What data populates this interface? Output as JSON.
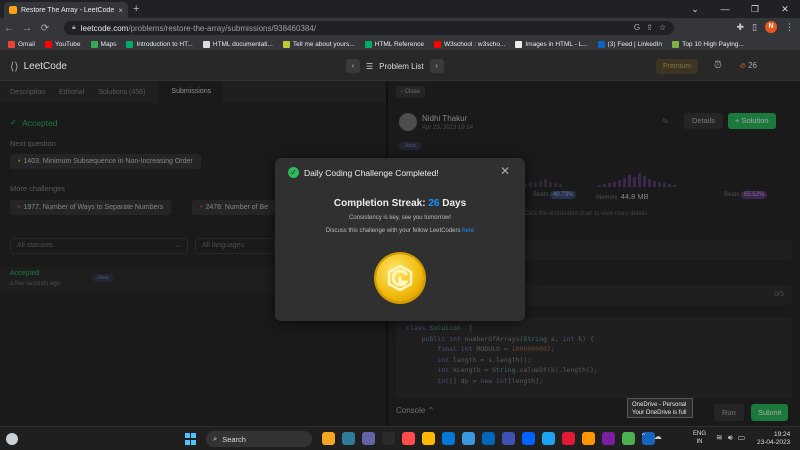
{
  "browser": {
    "tab_title": "Restore The Array - LeetCode",
    "tab_close": "×",
    "new_tab": "+",
    "url_host": "leetcode.com",
    "url_path": "/problems/restore-the-array/submissions/938460384/",
    "window_controls": [
      "⌄",
      "—",
      "❐",
      "✕"
    ],
    "profile_initial": "N",
    "bookmarks": [
      {
        "label": "Gmail",
        "color": "#ea4335"
      },
      {
        "label": "YouTube",
        "color": "#ff0000"
      },
      {
        "label": "Maps",
        "color": "#34a853"
      },
      {
        "label": "Introduction to HT...",
        "color": "#04aa6d"
      },
      {
        "label": "HTML documentati...",
        "color": "#dddddd"
      },
      {
        "label": "Tell me about yours...",
        "color": "#c0ca33"
      },
      {
        "label": "HTML Reference",
        "color": "#04aa6d"
      },
      {
        "label": "W3school : w3scho...",
        "color": "#ff0000"
      },
      {
        "label": "Images in HTML - L...",
        "color": "#eeeeee"
      },
      {
        "label": "(3) Feed | LinkedIn",
        "color": "#0a66c2"
      },
      {
        "label": "Top 10 High Paying...",
        "color": "#7cb342"
      }
    ]
  },
  "lc_nav": {
    "logo_text": "LeetCode",
    "problem_list": "Problem List",
    "premium": "Premium",
    "streak_count": "26"
  },
  "left": {
    "tabs": [
      "Description",
      "Editorial",
      "Solutions (456)",
      "Submissions"
    ],
    "accepted_label": "Accepted",
    "next_question_label": "Next question",
    "next_question": "1403. Minimum Subsequence in Non-Increasing Order",
    "more_challenges_label": "More challenges",
    "challenge1": "1977. Number of Ways to Separate Numbers",
    "challenge2": "2478. Number of Be",
    "filter_status": "All statuses",
    "filter_lang": "All languages",
    "submission": {
      "status": "Accepted",
      "time": "a few seconds ago",
      "lang": "Java"
    }
  },
  "right": {
    "close": "Close",
    "user_name": "Nidhi Thakur",
    "date": "Apr 23, 2023 19:24",
    "details": "Details",
    "solution": "+ Solution",
    "lang_tag": "Java",
    "beats_label": "Beats",
    "beats_runtime": "40.73%",
    "memory_label": "Memory",
    "memory_value": "44.8 MB",
    "beats_memory": "65.52%",
    "dist_note": "Click the distribution chart to view more details",
    "pagination": "0/5",
    "code_lines": [
      {
        "parts": [
          [
            "kw",
            "class "
          ],
          [
            "ty",
            "Solution"
          ],
          [
            "",
            "  {"
          ]
        ]
      },
      {
        "parts": [
          [
            "",
            "    "
          ],
          [
            "kw",
            "public "
          ],
          [
            "kw",
            "int "
          ],
          [
            "",
            "numberOfArrays("
          ],
          [
            "ty",
            "String "
          ],
          [
            "",
            "s, "
          ],
          [
            "kw",
            "int "
          ],
          [
            "",
            "k) {"
          ]
        ]
      },
      {
        "parts": [
          [
            "",
            ""
          ]
        ]
      },
      {
        "parts": [
          [
            "",
            "        "
          ],
          [
            "kw",
            "final "
          ],
          [
            "kw",
            "int "
          ],
          [
            "",
            "MODULO = "
          ],
          [
            "num",
            "1000000007"
          ],
          [
            "",
            ";"
          ]
        ]
      },
      {
        "parts": [
          [
            "",
            "        "
          ],
          [
            "kw",
            "int "
          ],
          [
            "",
            "length = s.length();"
          ]
        ]
      },
      {
        "parts": [
          [
            "",
            "        "
          ],
          [
            "kw",
            "int "
          ],
          [
            "",
            "kLength = "
          ],
          [
            "ty",
            "String"
          ],
          [
            "",
            ".valueOf(k).length();"
          ]
        ]
      },
      {
        "parts": [
          [
            "",
            "        "
          ],
          [
            "kw",
            "int"
          ],
          [
            "",
            "[] dp = "
          ],
          [
            "kw",
            "new "
          ],
          [
            "kw",
            "int"
          ],
          [
            "",
            "[length];"
          ]
        ]
      }
    ],
    "console": "Console ⌃",
    "run": "Run",
    "submit": "Submit"
  },
  "modal": {
    "title": "Daily Coding Challenge Completed!",
    "close": "✕",
    "streak_prefix": "Completion Streak:",
    "streak_value": "26",
    "streak_suffix": "Days",
    "message": "Consistency is key, see you tomorrow!",
    "discuss_text": "Discuss this challenge with your fellow LeetCoders",
    "discuss_link": "here"
  },
  "taskbar": {
    "search": "Search",
    "lang_top": "ENG",
    "lang_bottom": "IN",
    "time": "19:24",
    "date": "23-04-2023",
    "onedrive_line1": "OneDrive - Personal",
    "onedrive_line2": "Your OneDrive is full",
    "app_colors": [
      "#f5a623",
      "#2d7d9a",
      "#6264a7",
      "#2b2b2b",
      "#ff4b4b",
      "#ffb900",
      "#0078d4",
      "#3a96dd",
      "#0067b8",
      "#3f51b5",
      "#0062ff",
      "#1da1f2",
      "#e31837",
      "#ff9500",
      "#7b1fa2",
      "#4caf50",
      "#1565c0"
    ]
  }
}
